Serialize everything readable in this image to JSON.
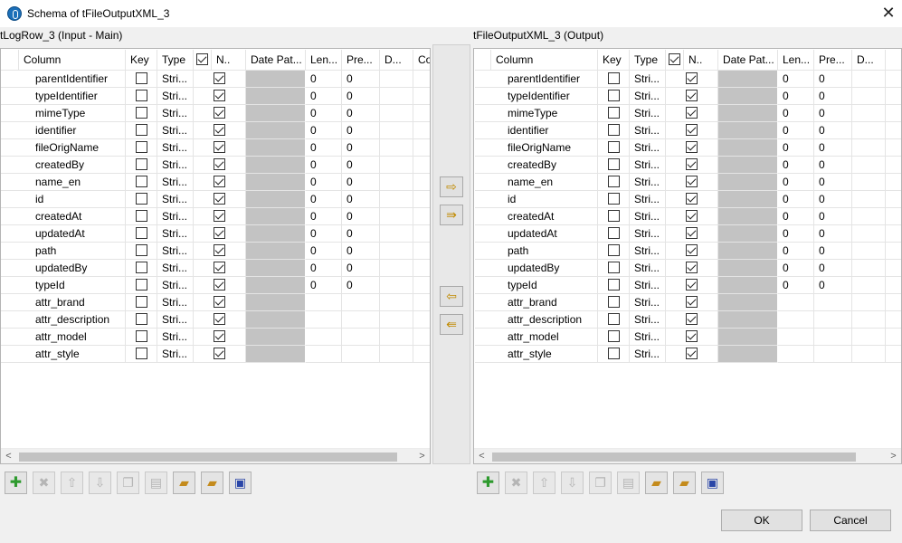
{
  "window": {
    "title": "Schema of tFileOutputXML_3",
    "close_symbol": "✕"
  },
  "left_panel": {
    "label": "tLogRow_3 (Input - Main)"
  },
  "right_panel": {
    "label": "tFileOutputXML_3 (Output)"
  },
  "headers_left": [
    "Column",
    "Key",
    "Type",
    "",
    "N..",
    "Date Pat...",
    "Len...",
    "Pre...",
    "D...",
    "Co"
  ],
  "headers_right": [
    "Column",
    "Key",
    "Type",
    "",
    "N..",
    "Date Pat...",
    "Len...",
    "Pre...",
    "D..."
  ],
  "rows": [
    {
      "column": "parentIdentifier",
      "key": false,
      "type": "Stri...",
      "nullable": true,
      "length": "0",
      "precision": "0"
    },
    {
      "column": "typeIdentifier",
      "key": false,
      "type": "Stri...",
      "nullable": true,
      "length": "0",
      "precision": "0"
    },
    {
      "column": "mimeType",
      "key": false,
      "type": "Stri...",
      "nullable": true,
      "length": "0",
      "precision": "0"
    },
    {
      "column": "identifier",
      "key": false,
      "type": "Stri...",
      "nullable": true,
      "length": "0",
      "precision": "0"
    },
    {
      "column": "fileOrigName",
      "key": false,
      "type": "Stri...",
      "nullable": true,
      "length": "0",
      "precision": "0"
    },
    {
      "column": "createdBy",
      "key": false,
      "type": "Stri...",
      "nullable": true,
      "length": "0",
      "precision": "0"
    },
    {
      "column": "name_en",
      "key": false,
      "type": "Stri...",
      "nullable": true,
      "length": "0",
      "precision": "0"
    },
    {
      "column": "id",
      "key": false,
      "type": "Stri...",
      "nullable": true,
      "length": "0",
      "precision": "0"
    },
    {
      "column": "createdAt",
      "key": false,
      "type": "Stri...",
      "nullable": true,
      "length": "0",
      "precision": "0"
    },
    {
      "column": "updatedAt",
      "key": false,
      "type": "Stri...",
      "nullable": true,
      "length": "0",
      "precision": "0"
    },
    {
      "column": "path",
      "key": false,
      "type": "Stri...",
      "nullable": true,
      "length": "0",
      "precision": "0"
    },
    {
      "column": "updatedBy",
      "key": false,
      "type": "Stri...",
      "nullable": true,
      "length": "0",
      "precision": "0"
    },
    {
      "column": "typeId",
      "key": false,
      "type": "Stri...",
      "nullable": true,
      "length": "0",
      "precision": "0"
    },
    {
      "column": "attr_brand",
      "key": false,
      "type": "Stri...",
      "nullable": true,
      "length": "",
      "precision": ""
    },
    {
      "column": "attr_description",
      "key": false,
      "type": "Stri...",
      "nullable": true,
      "length": "",
      "precision": ""
    },
    {
      "column": "attr_model",
      "key": false,
      "type": "Stri...",
      "nullable": true,
      "length": "",
      "precision": ""
    },
    {
      "column": "attr_style",
      "key": false,
      "type": "Stri...",
      "nullable": true,
      "length": "",
      "precision": ""
    }
  ],
  "scroll_arrows": {
    "left": "<",
    "right": ">"
  },
  "transfer_buttons": [
    {
      "name": "copy-selected-right-button",
      "icon": "arrow-right-icon",
      "symbol": "⇨"
    },
    {
      "name": "copy-all-right-button",
      "icon": "double-arrow-right-icon",
      "symbol": "⇛"
    },
    {
      "name": "copy-selected-left-button",
      "icon": "arrow-left-icon",
      "symbol": "⇦"
    },
    {
      "name": "copy-all-left-button",
      "icon": "double-arrow-left-icon",
      "symbol": "⇚"
    }
  ],
  "toolbar_buttons": [
    {
      "name": "add-button",
      "icon": "plus-icon",
      "symbol": "✚",
      "enabled": true,
      "cls": "plus"
    },
    {
      "name": "remove-button",
      "icon": "delete-icon",
      "symbol": "✖",
      "enabled": false,
      "cls": ""
    },
    {
      "name": "move-up-button",
      "icon": "arrow-up-icon",
      "symbol": "⇧",
      "enabled": false,
      "cls": ""
    },
    {
      "name": "move-down-button",
      "icon": "arrow-down-icon",
      "symbol": "⇩",
      "enabled": false,
      "cls": ""
    },
    {
      "name": "copy-button",
      "icon": "copy-icon",
      "symbol": "❐",
      "enabled": false,
      "cls": ""
    },
    {
      "name": "paste-button",
      "icon": "paste-icon",
      "symbol": "▤",
      "enabled": false,
      "cls": ""
    },
    {
      "name": "import-button",
      "icon": "folder-import-icon",
      "symbol": "▰",
      "enabled": true,
      "cls": "folder"
    },
    {
      "name": "export-button",
      "icon": "folder-export-icon",
      "symbol": "▰",
      "enabled": true,
      "cls": "folder"
    },
    {
      "name": "save-button",
      "icon": "save-disk-icon",
      "symbol": "▣",
      "enabled": true,
      "cls": "disk"
    }
  ],
  "buttons": {
    "ok": "OK",
    "cancel": "Cancel"
  }
}
